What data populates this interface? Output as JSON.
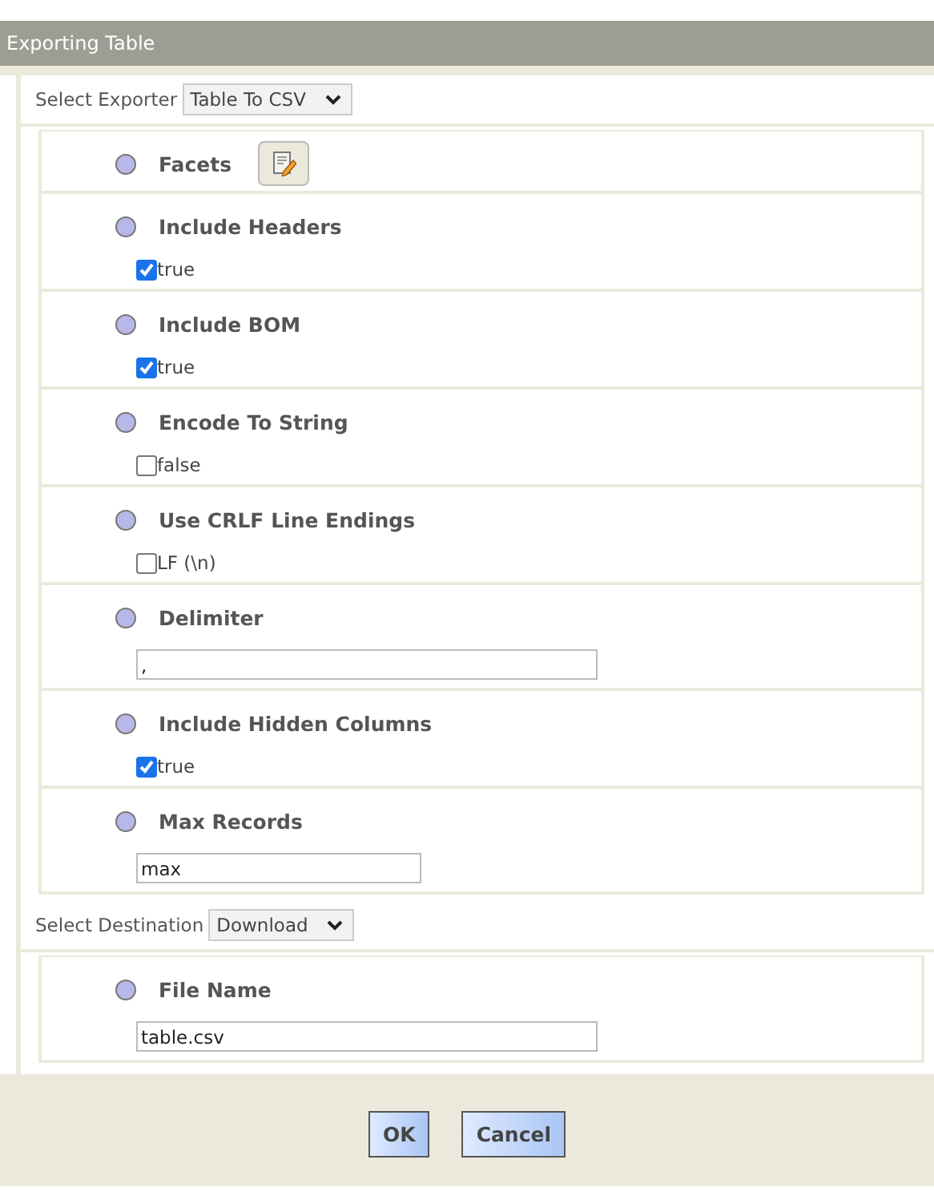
{
  "window": {
    "title": "Exporting Table"
  },
  "exporter": {
    "label": "Select Exporter",
    "value": "Table To CSV"
  },
  "properties": [
    {
      "kind": "button",
      "name": "Facets"
    },
    {
      "kind": "checkbox",
      "name": "Include Headers",
      "checked": true,
      "value": "true"
    },
    {
      "kind": "checkbox",
      "name": "Include BOM",
      "checked": true,
      "value": "true"
    },
    {
      "kind": "checkbox",
      "name": "Encode To String",
      "checked": false,
      "value": "false"
    },
    {
      "kind": "checkbox",
      "name": "Use CRLF Line Endings",
      "checked": false,
      "value": "LF (\\n)"
    },
    {
      "kind": "text",
      "name": "Delimiter",
      "value": ",",
      "wide": true
    },
    {
      "kind": "checkbox",
      "name": "Include Hidden Columns",
      "checked": true,
      "value": "true"
    },
    {
      "kind": "text",
      "name": "Max Records",
      "value": "max",
      "wide": false
    }
  ],
  "destination": {
    "label": "Select Destination",
    "value": "Download"
  },
  "destination_properties": [
    {
      "kind": "text",
      "name": "File Name",
      "value": "table.csv",
      "wide": true
    }
  ],
  "buttons": [
    "OK",
    "Cancel"
  ]
}
